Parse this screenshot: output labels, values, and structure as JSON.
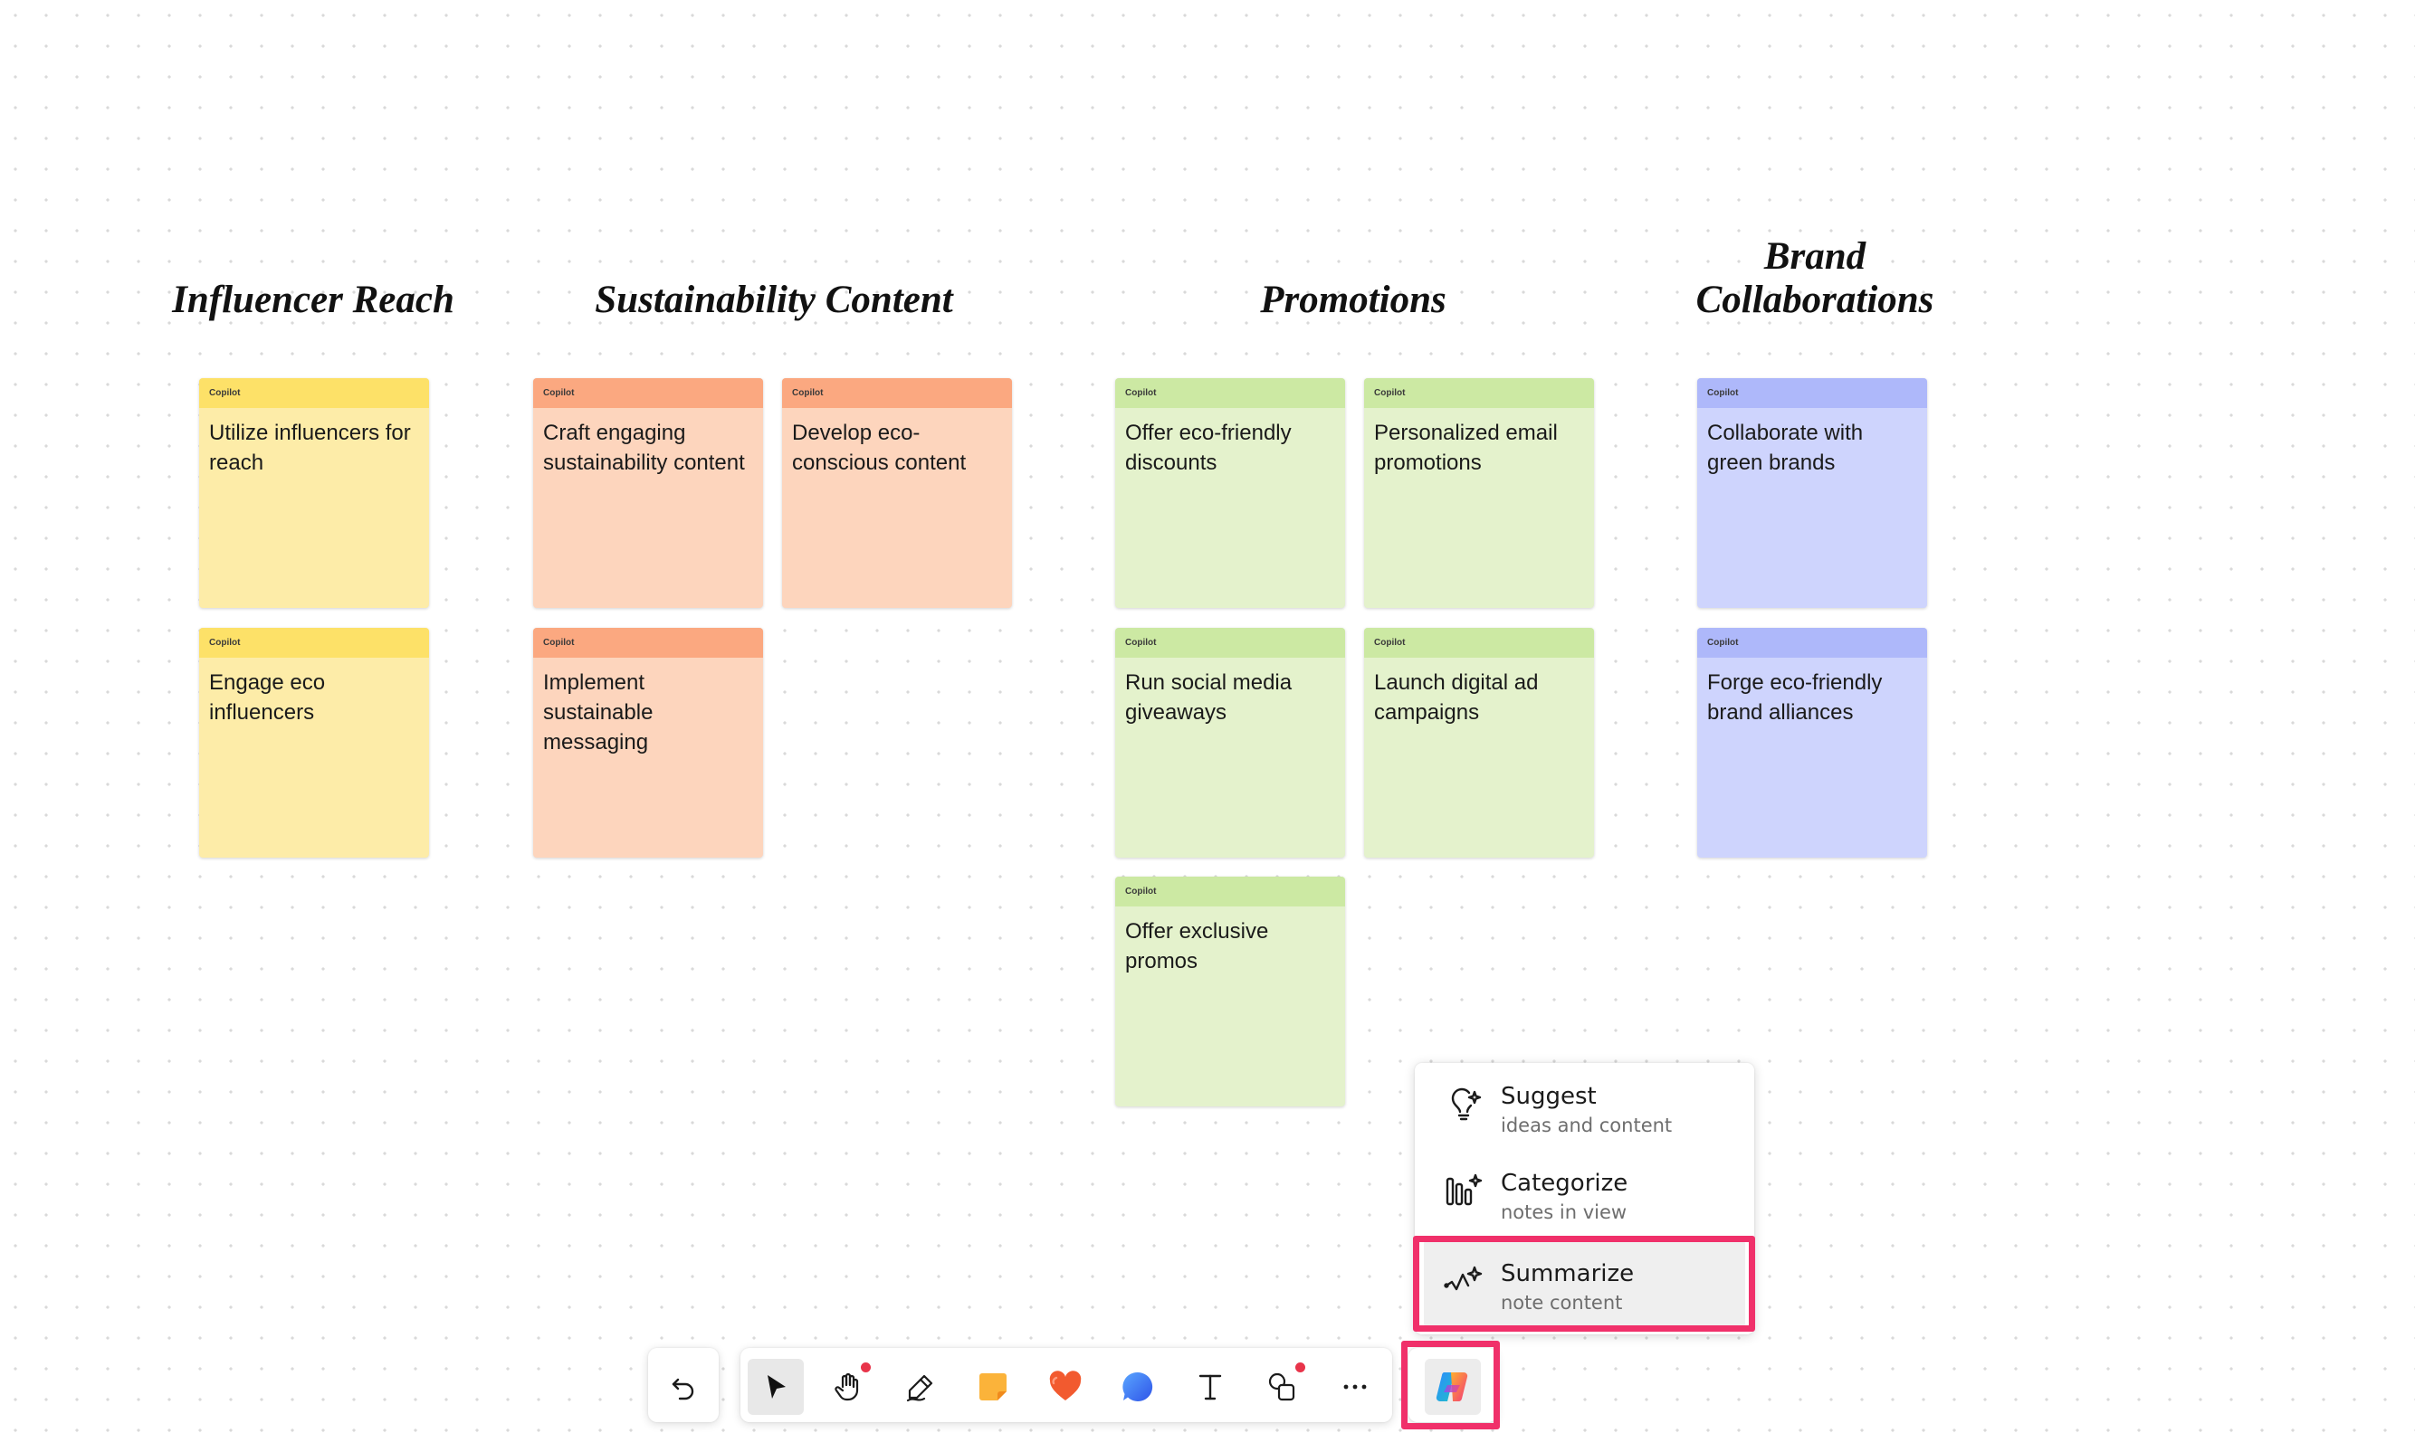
{
  "board": {
    "headings": {
      "influencer": "Influencer Reach",
      "sustainability": "Sustainability Content",
      "promotions": "Promotions",
      "brand_line1": "Brand",
      "brand_line2": "Collaborations"
    },
    "note_tag": "Copilot",
    "notes": {
      "influencer": [
        "Utilize influencers for reach",
        "Engage eco influencers"
      ],
      "sustainability": [
        "Craft engaging sustainability content",
        "Develop eco-conscious content",
        "Implement sustainable messaging"
      ],
      "promotions": [
        "Offer eco-friendly discounts",
        "Personalized email promotions",
        "Run social media giveaways",
        "Launch digital ad campaigns",
        "Offer exclusive promos"
      ],
      "brand": [
        "Collaborate with green brands",
        "Forge eco-friendly brand alliances"
      ]
    }
  },
  "colors": {
    "yellow_head": "#fde168",
    "yellow_body": "#fdeca8",
    "orange_head": "#fba880",
    "orange_body": "#fdd5bd",
    "green_head": "#cce9a3",
    "green_body": "#e4f2cc",
    "blue_head": "#aeb8fa",
    "blue_body": "#ced4fd",
    "highlight": "#f0306a"
  },
  "copilot_menu": {
    "items": [
      {
        "title": "Suggest",
        "subtitle": "ideas and content",
        "icon": "lightbulb-sparkle-icon"
      },
      {
        "title": "Categorize",
        "subtitle": "notes in view",
        "icon": "bars-sparkle-icon"
      },
      {
        "title": "Summarize",
        "subtitle": "note content",
        "icon": "summary-wave-sparkle-icon"
      }
    ],
    "active_item": "Summarize"
  },
  "toolbar": {
    "tools": [
      "undo-icon",
      "select-arrow-icon",
      "hand-pan-icon",
      "pen-icon",
      "sticky-note-icon",
      "heart-reaction-icon",
      "chat-bubble-icon",
      "text-icon",
      "shapes-icon",
      "more-icon",
      "copilot-icon"
    ],
    "active_tool": "select-arrow-icon"
  }
}
